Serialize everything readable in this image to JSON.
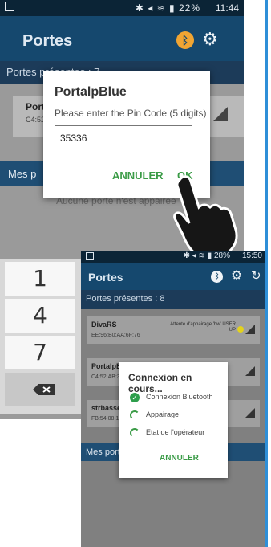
{
  "back_screen": {
    "status": {
      "battery": "22%",
      "time": "11:44"
    },
    "title": "Portes",
    "section_present": "Portes présentes : 7",
    "card": {
      "name": "Port",
      "mac": "C4:52"
    },
    "section_mine": "Mes p",
    "empty_text": "Aucune porte n'est appairée",
    "dialog": {
      "title": "PortalpBlue",
      "subtitle": "Please enter the Pin Code (5 digits)",
      "pin_value": "35336",
      "cancel": "ANNULER",
      "ok": "OK"
    },
    "keypad": [
      "1",
      "4",
      "7"
    ]
  },
  "front_screen": {
    "status": {
      "battery": "28%",
      "time": "15:50"
    },
    "title": "Portes",
    "section_present": "Portes présentes : 8",
    "devices": [
      {
        "name": "DivaRS",
        "mac": "EE:96:B0:AA:6F:76",
        "status": "Attente d'appairage 'bw' USER UP"
      },
      {
        "name": "PortalpB",
        "mac": "C4:52:AB:3"
      },
      {
        "name": "strbasse",
        "mac": "FB:54:08:1"
      }
    ],
    "section_mine": "Mes port",
    "dialog": {
      "title": "Connexion en cours...",
      "steps": [
        "Connexion Bluetooth",
        "Appairage",
        "Etat de l'opérateur"
      ],
      "cancel": "ANNULER"
    }
  },
  "colors": {
    "app_bar": "#15486e",
    "accent_green": "#3a9b46",
    "divider_line": "#2f8fd8"
  }
}
